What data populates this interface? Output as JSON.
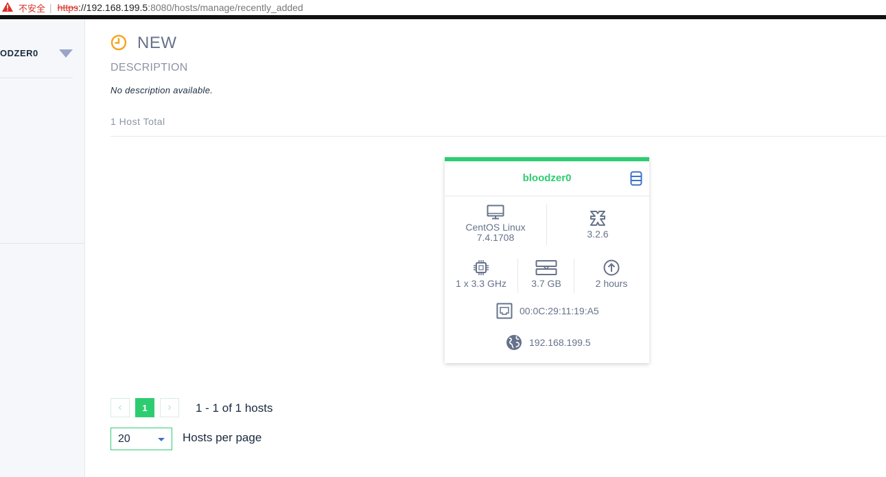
{
  "browser": {
    "security_label": "不安全",
    "url_scheme": "https",
    "url_host": "://192.168.199.5",
    "url_path": ":8080/hosts/manage/recently_added"
  },
  "sidebar": {
    "user_label": "ODZER0"
  },
  "page": {
    "title": "NEW",
    "description_label": "DESCRIPTION",
    "description_text": "No description available.",
    "host_total": "1 Host Total"
  },
  "host_card": {
    "name": "bloodzer0",
    "os_name": "CentOS Linux",
    "os_version": "7.4.1708",
    "osquery_version": "3.2.6",
    "cpu": "1 x 3.3 GHz",
    "memory": "3.7 GB",
    "uptime": "2 hours",
    "mac": "00:0C:29:11:19:A5",
    "ip": "192.168.199.5"
  },
  "pagination": {
    "prev_glyph": "‹",
    "current_page": "1",
    "next_glyph": "›",
    "summary": "1 - 1 of 1 hosts",
    "per_page_value": "20",
    "per_page_label": "Hosts per page"
  },
  "colors": {
    "accent_green": "#2ecc71",
    "clock_orange": "#f5a623",
    "db_blue": "#3b73c9",
    "text_dark": "#192a3e",
    "text_muted": "#66728a"
  }
}
